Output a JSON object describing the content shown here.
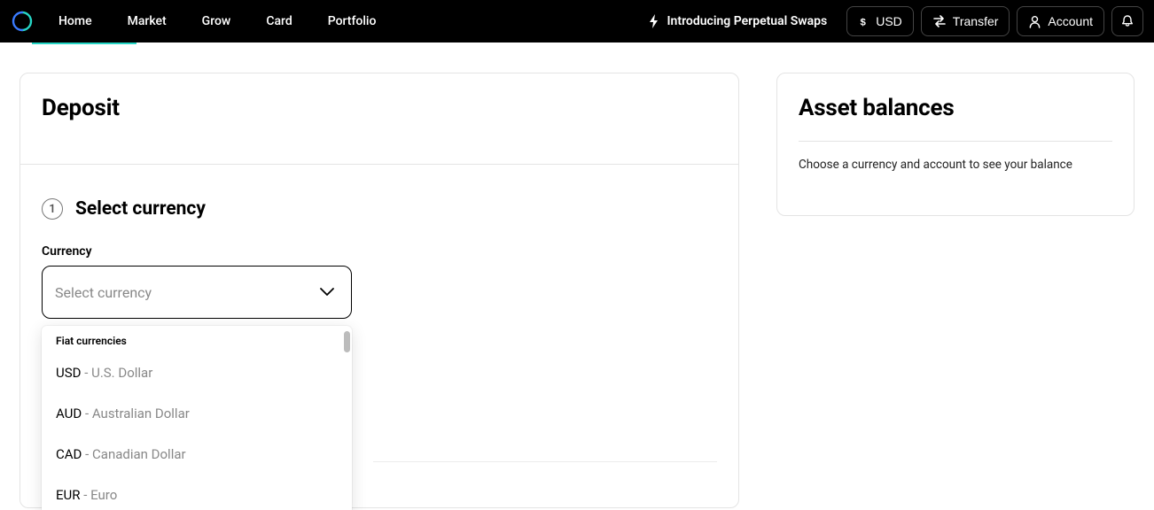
{
  "nav": {
    "links": [
      "Home",
      "Market",
      "Grow",
      "Card",
      "Portfolio"
    ],
    "promo": "Introducing Perpetual Swaps",
    "currency_label": "USD",
    "transfer_label": "Transfer",
    "account_label": "Account"
  },
  "deposit": {
    "title": "Deposit",
    "step1_number": "1",
    "step1_label": "Select currency",
    "currency_field_label": "Currency",
    "currency_placeholder": "Select currency",
    "dropdown": {
      "group_label": "Fiat currencies",
      "items": [
        {
          "code": "USD",
          "name": "U.S. Dollar"
        },
        {
          "code": "AUD",
          "name": "Australian Dollar"
        },
        {
          "code": "CAD",
          "name": "Canadian Dollar"
        },
        {
          "code": "EUR",
          "name": "Euro"
        }
      ]
    }
  },
  "balances": {
    "title": "Asset balances",
    "empty": "Choose a currency and account to see your balance"
  }
}
